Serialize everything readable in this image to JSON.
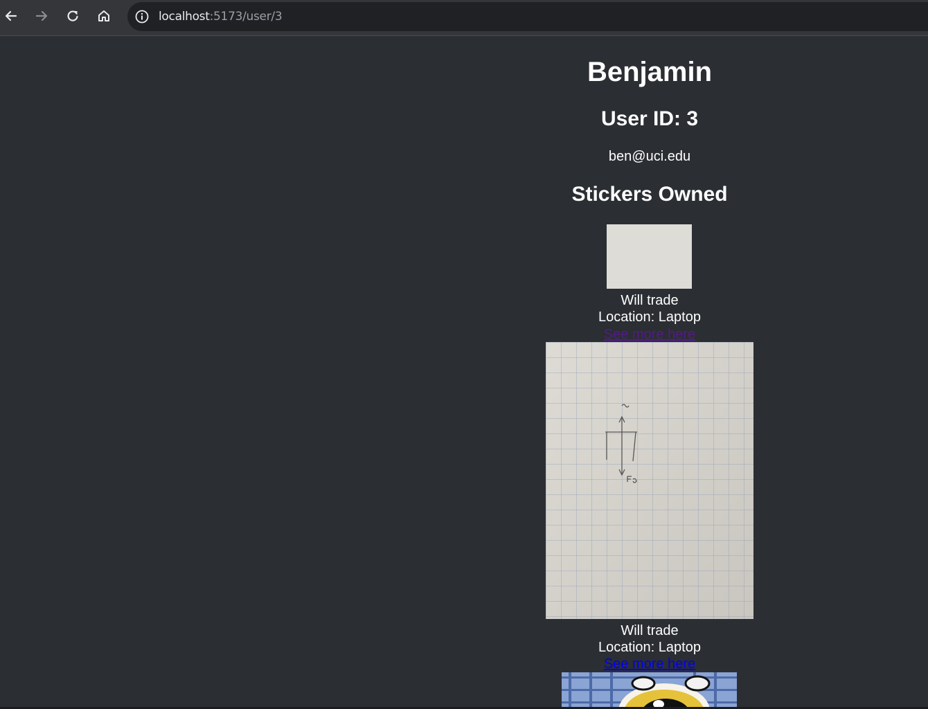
{
  "browser": {
    "url_host": "localhost",
    "url_path": ":5173/user/3",
    "icons": [
      "back-arrow-icon",
      "forward-arrow-icon",
      "reload-icon",
      "home-icon",
      "info-icon"
    ]
  },
  "profile": {
    "name": "Benjamin",
    "user_id_label": "User ID: 3",
    "email": "ben@uci.edu",
    "stickers_heading": "Stickers Owned"
  },
  "stickers": [
    {
      "status": "Will trade",
      "location": "Location: Laptop",
      "link": "See more here",
      "link_visited": true
    },
    {
      "status": "Will trade",
      "location": "Location: Laptop",
      "link": "See more here",
      "link_visited": false
    }
  ],
  "colors": {
    "page_bg": "#2b2e33",
    "text": "#ffffff",
    "link_visited": "#551a8b",
    "link_unvisited": "#0000ee"
  }
}
